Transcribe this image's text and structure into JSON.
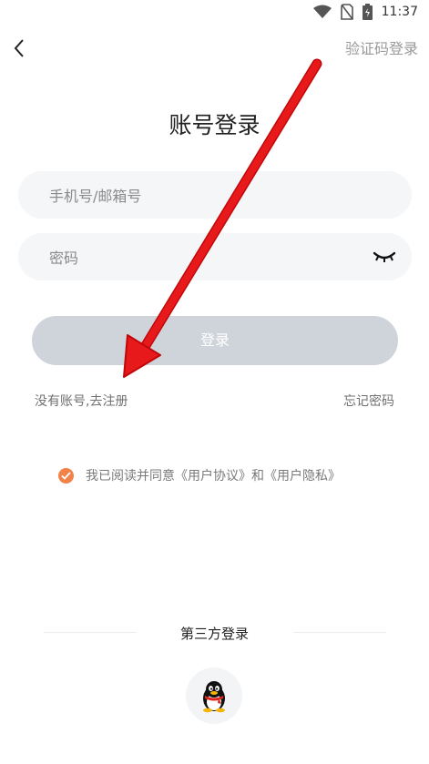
{
  "status_bar": {
    "time": "11:37"
  },
  "header": {
    "back_icon": "chevron-left-icon",
    "sms_login_label": "验证码登录"
  },
  "page": {
    "title": "账号登录"
  },
  "form": {
    "phone_placeholder": "手机号/邮箱号",
    "password_placeholder": "密码",
    "login_label": "登录"
  },
  "links": {
    "register": "没有账号,去注册",
    "forgot": "忘记密码"
  },
  "agreement": {
    "text": "我已阅读并同意《用户协议》和《用户隐私》",
    "checked": true
  },
  "third_party": {
    "label": "第三方登录",
    "providers": [
      "qq"
    ]
  },
  "colors": {
    "accent": "#f0824a",
    "button_disabled": "#cfd4db",
    "input_bg": "#f4f6f8",
    "annotation_arrow": "#e8191a"
  }
}
